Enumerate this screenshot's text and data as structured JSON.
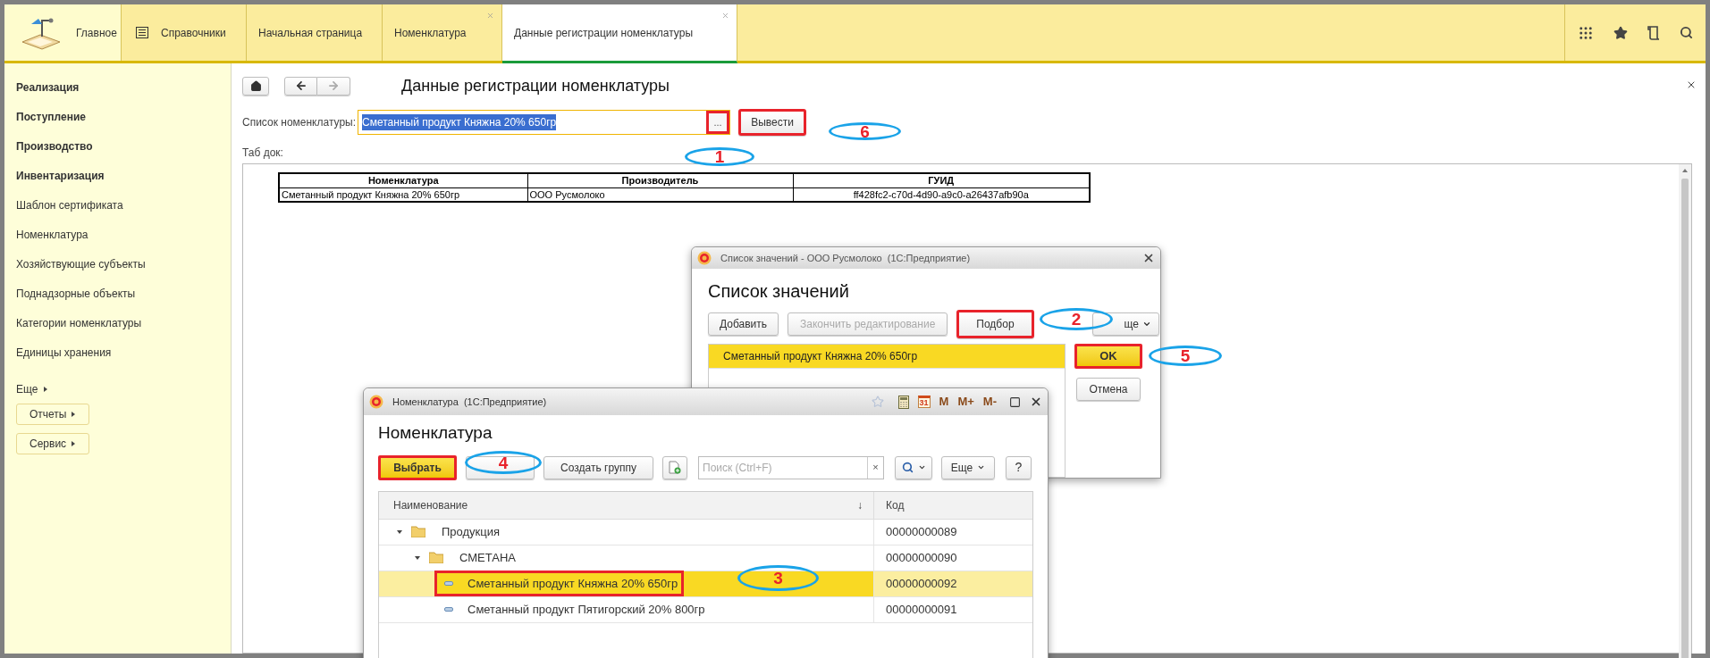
{
  "tabs": [
    {
      "kind": "home",
      "label": "Главное",
      "selected": false,
      "closable": false
    },
    {
      "kind": "section",
      "label": "Справочники",
      "selected": false,
      "closable": false
    },
    {
      "kind": "page",
      "label": "Начальная страница",
      "selected": false,
      "closable": false
    },
    {
      "kind": "page",
      "label": "Номенклатура",
      "selected": false,
      "closable": true
    },
    {
      "kind": "page",
      "label": "Данные регистрации номенклатуры",
      "selected": true,
      "closable": true
    }
  ],
  "sidebar": {
    "items": [
      {
        "label": "Реализация",
        "kind": "section"
      },
      {
        "label": "Поступление",
        "kind": "section"
      },
      {
        "label": "Производство",
        "kind": "section"
      },
      {
        "label": "Инвентаризация",
        "kind": "section"
      },
      {
        "label": "Шаблон сертификата",
        "kind": "link"
      },
      {
        "label": "Номенклатура",
        "kind": "link"
      },
      {
        "label": "Хозяйствующие субъекты",
        "kind": "link"
      },
      {
        "label": "Поднадзорные объекты",
        "kind": "link"
      },
      {
        "label": "Категории номенклатуры",
        "kind": "link"
      },
      {
        "label": "Единицы хранения",
        "kind": "link"
      }
    ],
    "more": "Еще",
    "buttons": [
      "Отчеты",
      "Сервис"
    ]
  },
  "form": {
    "title": "Данные регистрации номенклатуры",
    "list_field": {
      "label": "Список номенклатуры:",
      "value": "Сметанный продукт Княжна 20% 650гр",
      "selected": true
    },
    "choose_button": {
      "label": "...",
      "callout": true
    },
    "output_button": {
      "label": "Вывести",
      "callout": true
    },
    "tab_doc_label": "Таб док:",
    "table": {
      "columns": [
        "Номенклатура",
        "Производитель",
        "ГУИД"
      ],
      "rows": [
        [
          "Сметанный продукт Княжна 20% 650гр",
          "ООО Русмолоко",
          "ff428fc2-c70d-4d90-a9c0-a26437afb90a"
        ]
      ]
    }
  },
  "values_dialog": {
    "title": "Список значений - ООО Русмолоко  (1С:Предприятие)",
    "heading": "Список значений",
    "toolbar": [
      {
        "label": "Добавить",
        "disabled": false,
        "callout": false,
        "dropdown": false
      },
      {
        "label": "Закончить редактирование",
        "disabled": true,
        "callout": false,
        "dropdown": false
      },
      {
        "label": "Подбор",
        "disabled": false,
        "callout": true,
        "dropdown": false
      },
      {
        "label": "ще",
        "disabled": false,
        "callout": false,
        "dropdown": true
      }
    ],
    "rows": [
      {
        "label": "Сметанный продукт Княжна 20% 650гр",
        "selected": true
      }
    ],
    "ok": {
      "label": "OK",
      "callout": true
    },
    "cancel": {
      "label": "Отмена",
      "callout": false
    }
  },
  "catalog_dialog": {
    "title": "Номенклатура  (1С:Предприятие)",
    "tools": [
      {
        "kind": "calendar",
        "label": "31"
      },
      {
        "kind": "memory",
        "label": "M"
      },
      {
        "kind": "memory",
        "label": "M+"
      },
      {
        "kind": "memory",
        "label": "M-"
      }
    ],
    "heading": "Номенклатура",
    "choose": {
      "label": "Выбрать",
      "callout": true
    },
    "create_group": "Создать группу",
    "search_placeholder": "Поиск (Ctrl+F)",
    "clear": "×",
    "more": "Еще",
    "help": "?",
    "columns": [
      {
        "label": "Наименование",
        "sort_mark": "↓"
      },
      {
        "label": "Код"
      }
    ],
    "tree": [
      {
        "kind": "folder",
        "label": "Продукция",
        "code": "00000000089",
        "expanded": true,
        "selected": false,
        "children": [
          {
            "kind": "folder",
            "label": "СМЕТАНА",
            "code": "00000000090",
            "expanded": true,
            "selected": false,
            "children": [
              {
                "kind": "item",
                "label": "Сметанный продукт Княжна 20% 650гр",
                "code": "00000000092",
                "selected": true,
                "callout": true
              },
              {
                "kind": "item",
                "label": "Сметанный продукт Пятигорский 20% 800гр",
                "code": "00000000091",
                "selected": false,
                "callout": false
              }
            ]
          }
        ]
      }
    ]
  },
  "callouts": [
    {
      "label": "1"
    },
    {
      "label": "6"
    },
    {
      "label": "2"
    },
    {
      "label": "5"
    },
    {
      "label": "4"
    },
    {
      "label": "3"
    }
  ]
}
